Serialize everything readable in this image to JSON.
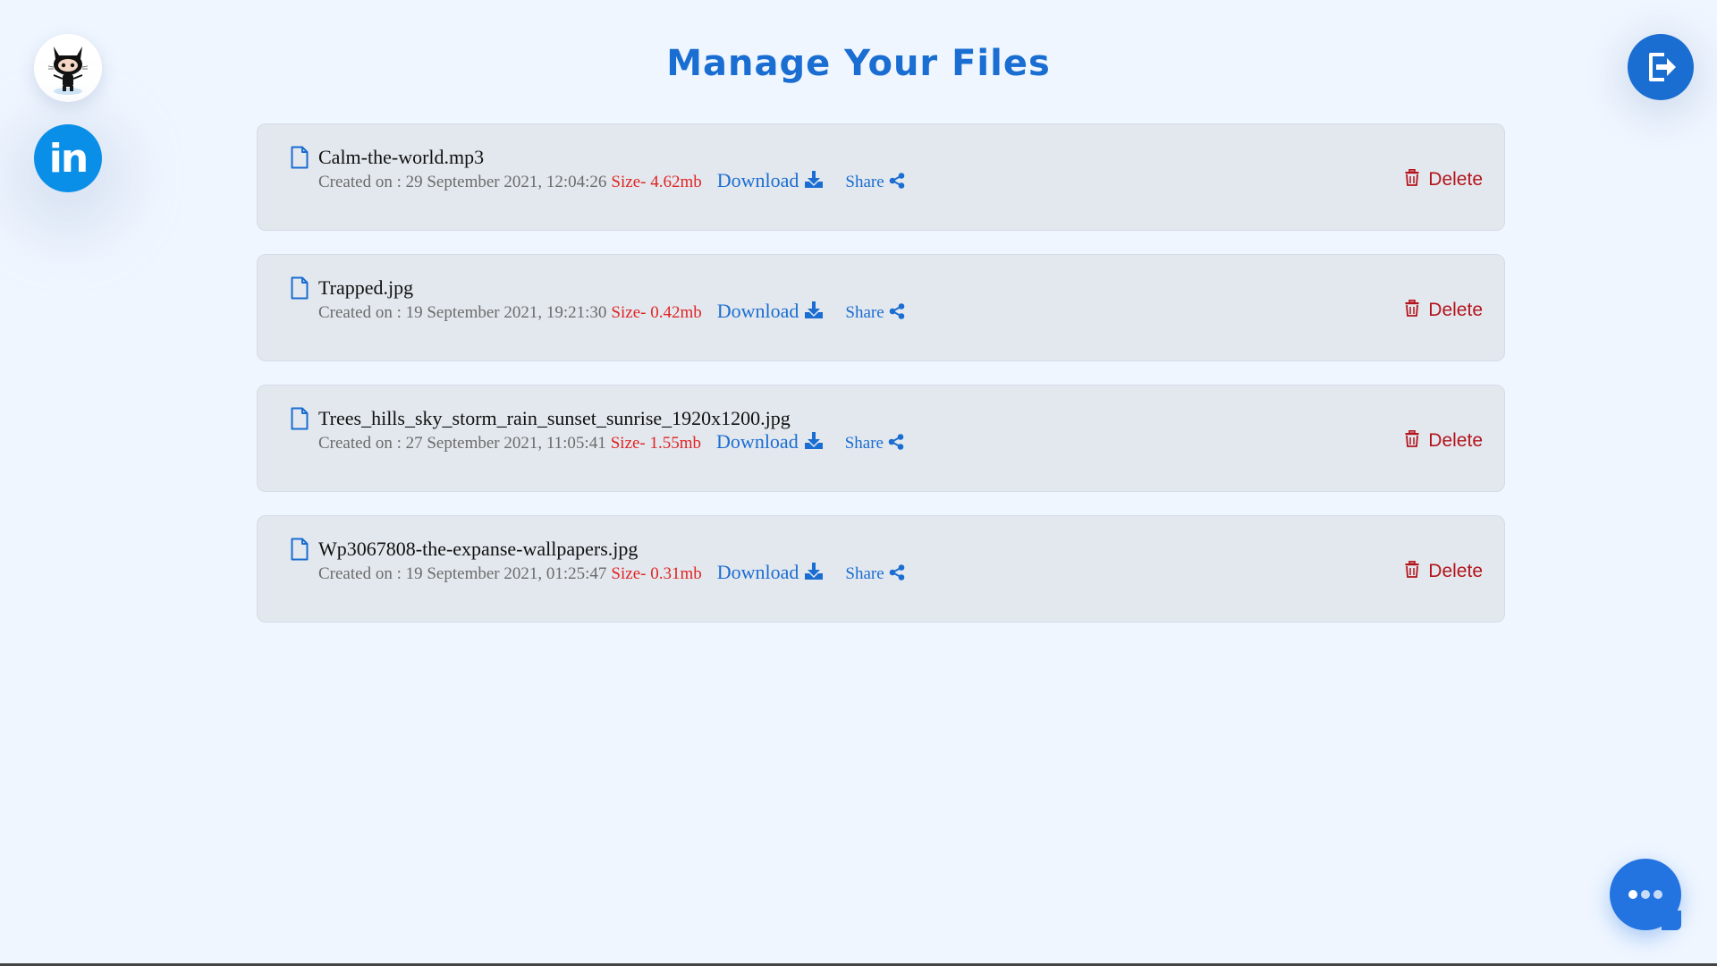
{
  "page": {
    "title": "Manage Your Files"
  },
  "social": {
    "github_icon": "github-octocat-icon",
    "linkedin_label": "in"
  },
  "header": {
    "logout_icon": "logout-icon"
  },
  "files": [
    {
      "name": "Calm-the-world.mp3",
      "created": "Created on : 29 September 2021, 12:04:26",
      "size": "Size- 4.62mb",
      "download_label": "Download",
      "share_label": "Share",
      "delete_label": "Delete"
    },
    {
      "name": "Trapped.jpg",
      "created": "Created on : 19 September 2021, 19:21:30",
      "size": "Size- 0.42mb",
      "download_label": "Download",
      "share_label": "Share",
      "delete_label": "Delete"
    },
    {
      "name": "Trees_hills_sky_storm_rain_sunset_sunrise_1920x1200.jpg",
      "created": "Created on : 27 September 2021, 11:05:41",
      "size": "Size- 1.55mb",
      "download_label": "Download",
      "share_label": "Share",
      "delete_label": "Delete"
    },
    {
      "name": "Wp3067808-the-expanse-wallpapers.jpg",
      "created": "Created on : 19 September 2021, 01:25:47",
      "size": "Size- 0.31mb",
      "download_label": "Download",
      "share_label": "Share",
      "delete_label": "Delete"
    }
  ],
  "colors": {
    "background": "#eff6ff",
    "accent": "#1a6dd1",
    "size_text": "#e02424",
    "delete": "#b3141c",
    "card": "#e3e8ee"
  },
  "chat": {
    "icon": "chat-bubble-icon"
  }
}
